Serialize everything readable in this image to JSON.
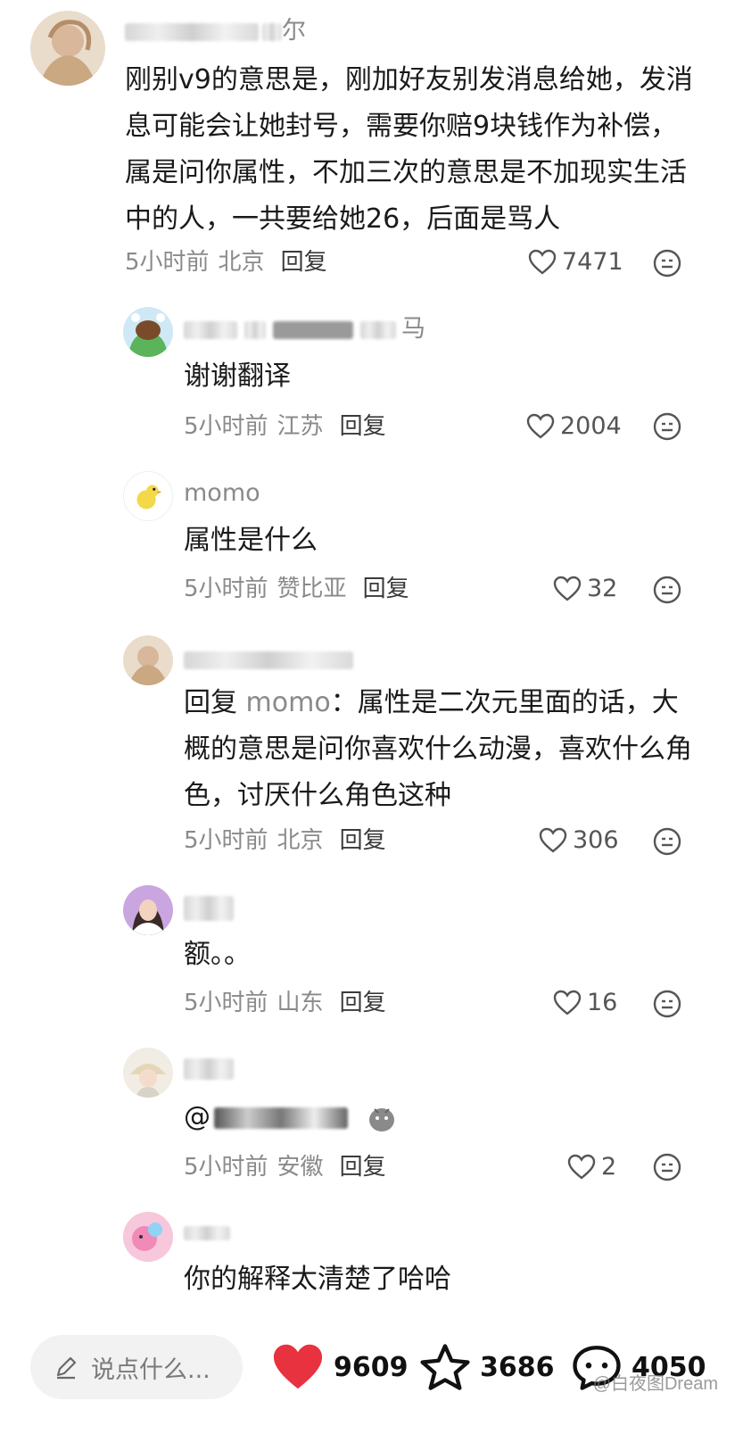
{
  "comments": [
    {
      "text": "刚别v9的意思是，刚加好友别发消息给她，发消息可能会让她封号，需要你赔9块钱作为补偿，属是问你属性，不加三次的意思是不加现实生活中的人，一共要给她26，后面是骂人",
      "username_visible": "尔",
      "time": "5小时前",
      "location": "北京",
      "reply_label": "回复",
      "likes": "7471"
    },
    {
      "text": "谢谢翻译",
      "username_visible": "马",
      "time": "5小时前",
      "location": "江苏",
      "reply_label": "回复",
      "likes": "2004"
    },
    {
      "username": "momo",
      "text": "属性是什么",
      "time": "5小时前",
      "location": "赞比亚",
      "reply_label": "回复",
      "likes": "32"
    },
    {
      "reply_prefix": "回复",
      "reply_to": "momo",
      "reply_colon": "：",
      "text": "属性是二次元里面的话，大概的意思是问你喜欢什么动漫，喜欢什么角色，讨厌什么角色这种",
      "time": "5小时前",
      "location": "北京",
      "reply_label": "回复",
      "likes": "306"
    },
    {
      "text": "额。。",
      "time": "5小时前",
      "location": "山东",
      "reply_label": "回复",
      "likes": "16"
    },
    {
      "text_prefix": "@",
      "time": "5小时前",
      "location": "安徽",
      "reply_label": "回复",
      "likes": "2"
    },
    {
      "text": "你的解释太清楚了哈哈"
    }
  ],
  "bottom_bar": {
    "input_placeholder": "说点什么...",
    "likes": "9609",
    "favorites": "3686",
    "comments": "4050"
  },
  "watermark": "@白夜图Dream",
  "colors": {
    "like_red": "#e8323f",
    "muted_text": "#8a8a8a"
  }
}
